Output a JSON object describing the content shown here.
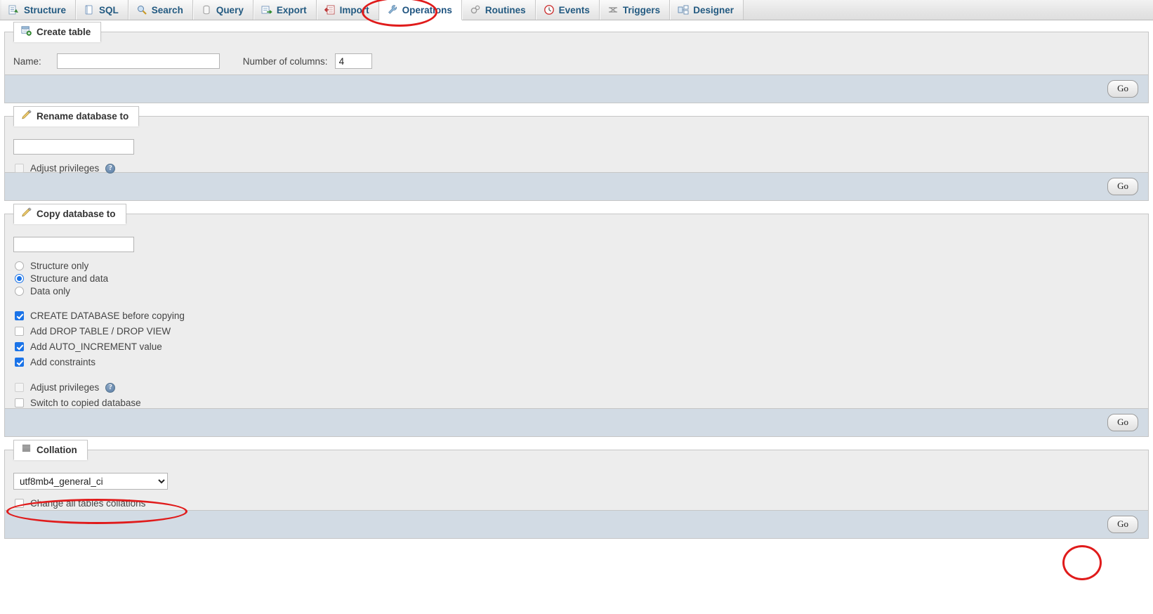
{
  "nav": {
    "tabs": [
      {
        "label": "Structure",
        "icon": "structure-icon",
        "active": false
      },
      {
        "label": "SQL",
        "icon": "sql-icon",
        "active": false
      },
      {
        "label": "Search",
        "icon": "search-icon",
        "active": false
      },
      {
        "label": "Query",
        "icon": "query-icon",
        "active": false
      },
      {
        "label": "Export",
        "icon": "export-icon",
        "active": false
      },
      {
        "label": "Import",
        "icon": "import-icon",
        "active": false
      },
      {
        "label": "Operations",
        "icon": "wrench-icon",
        "active": true
      },
      {
        "label": "Routines",
        "icon": "routines-icon",
        "active": false
      },
      {
        "label": "Events",
        "icon": "clock-icon",
        "active": false
      },
      {
        "label": "Triggers",
        "icon": "triggers-icon",
        "active": false
      },
      {
        "label": "Designer",
        "icon": "designer-icon",
        "active": false
      }
    ]
  },
  "create_table": {
    "legend": "Create table",
    "legend_icon": "new-table-icon",
    "name_label": "Name:",
    "name_value": "",
    "columns_label": "Number of columns:",
    "columns_value": "4",
    "go_label": "Go"
  },
  "rename_database": {
    "legend": "Rename database to",
    "legend_icon": "pencil-icon",
    "name_value": "",
    "adjust_privileges_label": "Adjust privileges",
    "adjust_privileges_checked": false,
    "help_icon": "help-icon",
    "go_label": "Go"
  },
  "copy_database": {
    "legend": "Copy database to",
    "legend_icon": "pencil-icon",
    "name_value": "",
    "radio_options": [
      {
        "label": "Structure only",
        "selected": false
      },
      {
        "label": "Structure and data",
        "selected": true
      },
      {
        "label": "Data only",
        "selected": false
      }
    ],
    "checkbox_options": [
      {
        "label": "CREATE DATABASE before copying",
        "checked": true
      },
      {
        "label": "Add DROP TABLE / DROP VIEW",
        "checked": false
      },
      {
        "label": "Add AUTO_INCREMENT value",
        "checked": true
      },
      {
        "label": "Add constraints",
        "checked": true
      }
    ],
    "adjust_privileges_label": "Adjust privileges",
    "adjust_privileges_checked": false,
    "help_icon": "help-icon",
    "switch_label": "Switch to copied database",
    "switch_checked": false,
    "go_label": "Go"
  },
  "collation": {
    "legend": "Collation",
    "legend_icon": "list-icon",
    "selected": "utf8mb4_general_ci",
    "options": [
      "utf8mb4_general_ci"
    ],
    "change_all_label": "Change all tables collations",
    "change_all_checked": false,
    "go_label": "Go"
  },
  "annotations": {
    "accent_color": "#e01b1b",
    "highlights": [
      "operations-tab",
      "collation-select",
      "collation-go-button"
    ]
  }
}
